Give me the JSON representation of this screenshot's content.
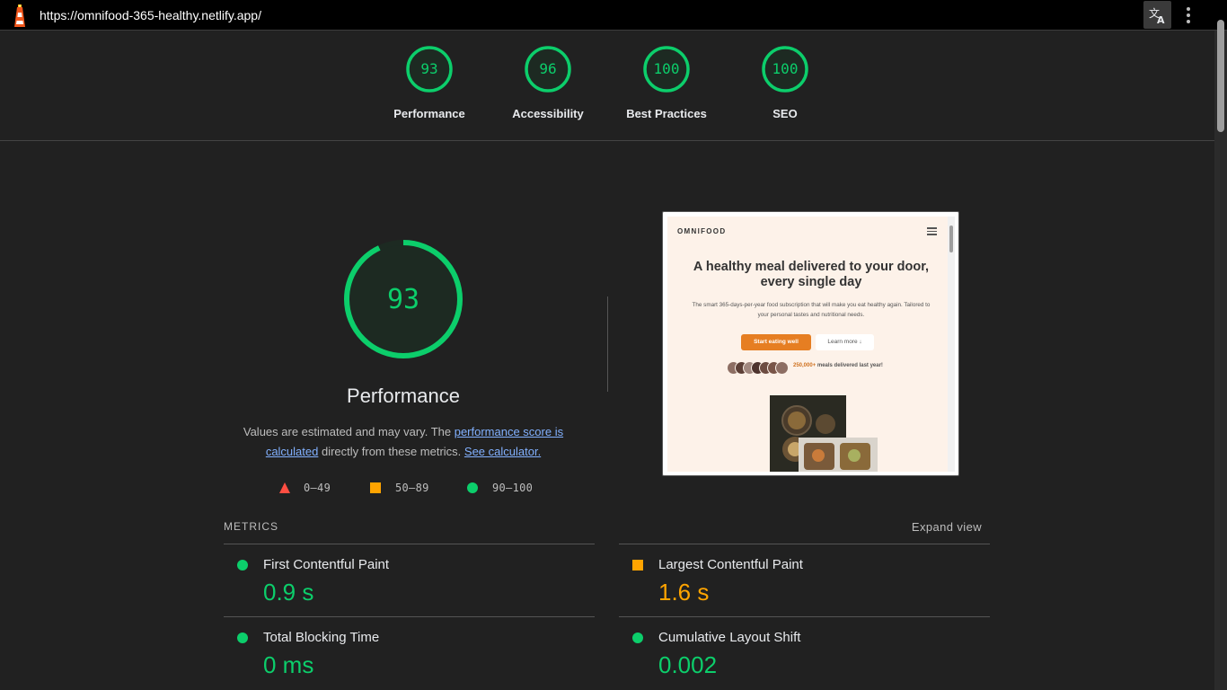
{
  "topbar": {
    "url": "https://omnifood-365-healthy.netlify.app/",
    "icons": {
      "logo": "lighthouse-icon",
      "translate": "translate-icon",
      "menu": "kebab-menu-icon"
    }
  },
  "colors": {
    "pass": "#0cce6b",
    "average": "#ffa400",
    "fail": "#ff4e42",
    "background": "#212121"
  },
  "scores": [
    {
      "label": "Performance",
      "value": "93"
    },
    {
      "label": "Accessibility",
      "value": "96"
    },
    {
      "label": "Best Practices",
      "value": "100"
    },
    {
      "label": "SEO",
      "value": "100"
    }
  ],
  "performance": {
    "score": "93",
    "title": "Performance",
    "desc_prefix": "Values are estimated and may vary. The ",
    "link_score": "performance score is calculated",
    "desc_mid": " directly from these metrics. ",
    "link_calc": "See calculator.",
    "legend": [
      {
        "shape": "triangle",
        "range": "0–49"
      },
      {
        "shape": "square",
        "range": "50–89"
      },
      {
        "shape": "circle",
        "range": "90–100"
      }
    ]
  },
  "preview": {
    "logo": "OMNIFOOD",
    "heading": "A healthy meal delivered to your door, every single day",
    "subtitle": "The smart 365-days-per-year food subscription that will make you eat healthy again. Tailored to your personal tastes and nutritional needs.",
    "btn_primary": "Start eating well",
    "btn_secondary": "Learn more ↓",
    "stat_highlight": "250,000+",
    "stat_text": " meals delivered last year!"
  },
  "metrics": {
    "header": "METRICS",
    "expand": "Expand view",
    "items": [
      {
        "name": "First Contentful Paint",
        "value": "0.9 s",
        "status": "pass"
      },
      {
        "name": "Largest Contentful Paint",
        "value": "1.6 s",
        "status": "average"
      },
      {
        "name": "Total Blocking Time",
        "value": "0 ms",
        "status": "pass"
      },
      {
        "name": "Cumulative Layout Shift",
        "value": "0.002",
        "status": "pass"
      }
    ]
  }
}
